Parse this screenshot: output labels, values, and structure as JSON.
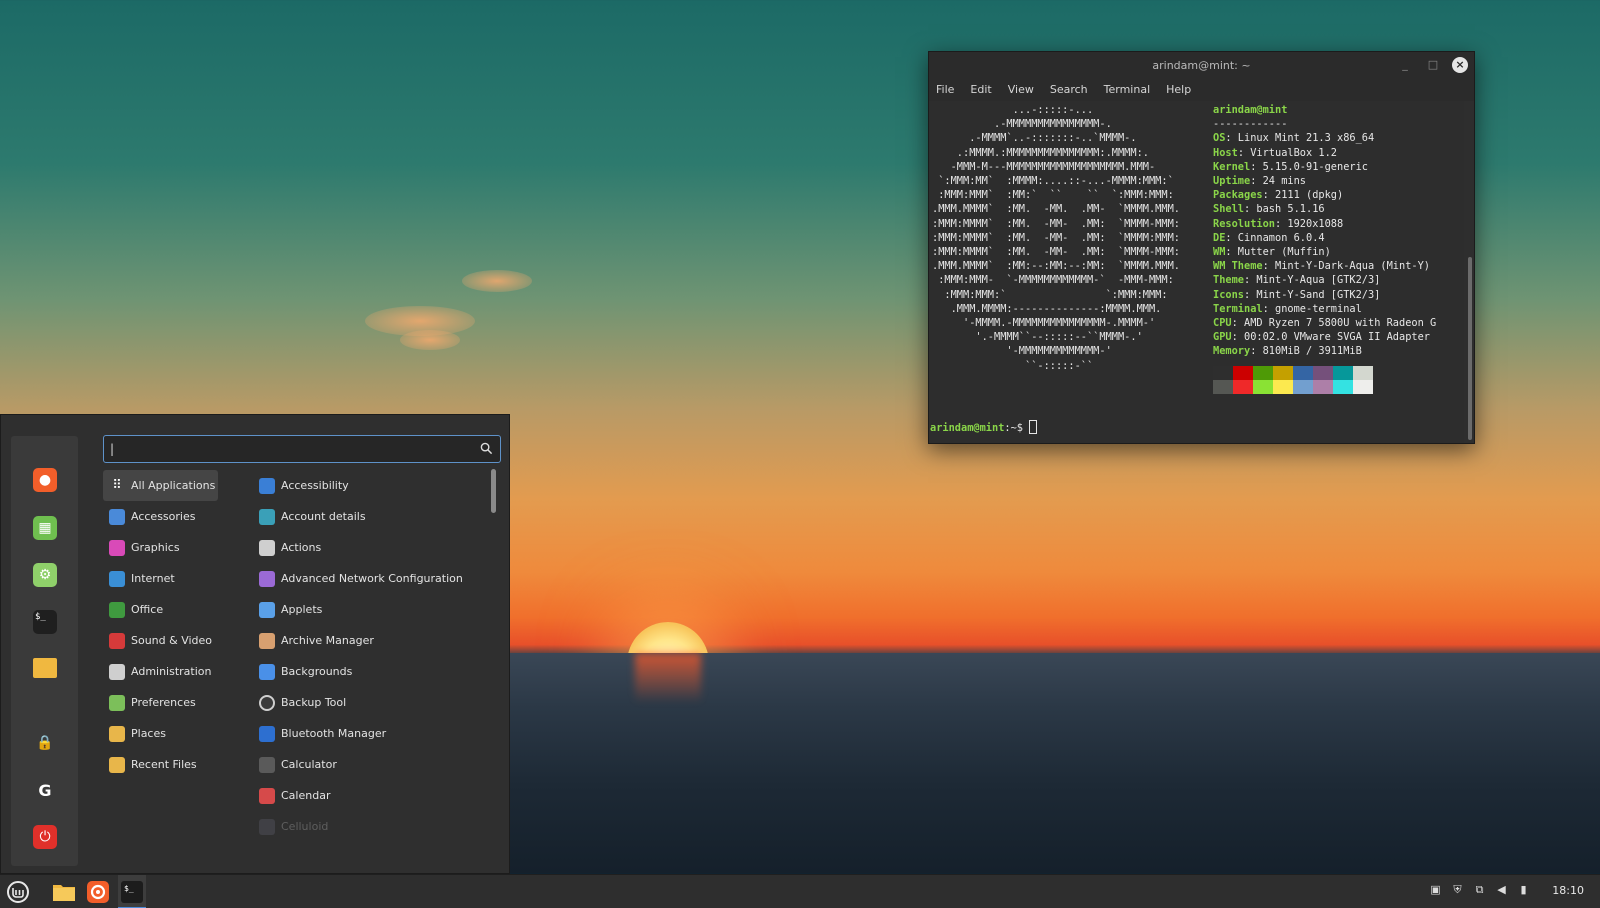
{
  "terminal": {
    "title": "arindam@mint: ~",
    "menu": [
      "File",
      "Edit",
      "View",
      "Search",
      "Terminal",
      "Help"
    ],
    "ascii_lines": [
      "             ...-:::::-...",
      "          .-MMMMMMMMMMMMMMM-.",
      "      .-MMMM`..-:::::::-..`MMMM-.",
      "    .:MMMM.:MMMMMMMMMMMMMMM:.MMMM:.",
      "   -MMM-M---MMMMMMMMMMMMMMMMMMM.MMM-",
      " `:MMM:MM`  :MMMM:....::-...-MMMM:MMM:`",
      " :MMM:MMM`  :MM:`  ``    ``  `:MMM:MMM:",
      ".MMM.MMMM`  :MM.  -MM.  .MM-  `MMMM.MMM.",
      ":MMM:MMMM`  :MM.  -MM-  .MM:  `MMMM-MMM:",
      ":MMM:MMMM`  :MM.  -MM-  .MM:  `MMMM:MMM:",
      ":MMM:MMMM`  :MM.  -MM-  .MM:  `MMMM-MMM:",
      ".MMM.MMMM`  :MM:--:MM:--:MM:  `MMMM.MMM.",
      " :MMM:MMM-  `-MMMMMMMMMMMM-`  -MMM-MMM:",
      "  :MMM:MMM:`                `:MMM:MMM:",
      "   .MMM.MMMM:--------------:MMMM.MMM.",
      "     '-MMMM.-MMMMMMMMMMMMMMM-.MMMM-'",
      "       '.-MMMM``--:::::--``MMMM-.'",
      "            '-MMMMMMMMMMMMM-'",
      "               ``-:::::-``"
    ],
    "user_host": "arindam@mint",
    "separator": "------------",
    "info": [
      {
        "key": "OS",
        "value": "Linux Mint 21.3 x86_64"
      },
      {
        "key": "Host",
        "value": "VirtualBox 1.2"
      },
      {
        "key": "Kernel",
        "value": "5.15.0-91-generic"
      },
      {
        "key": "Uptime",
        "value": "24 mins"
      },
      {
        "key": "Packages",
        "value": "2111 (dpkg)"
      },
      {
        "key": "Shell",
        "value": "bash 5.1.16"
      },
      {
        "key": "Resolution",
        "value": "1920x1088"
      },
      {
        "key": "DE",
        "value": "Cinnamon 6.0.4"
      },
      {
        "key": "WM",
        "value": "Mutter (Muffin)"
      },
      {
        "key": "WM Theme",
        "value": "Mint-Y-Dark-Aqua (Mint-Y)"
      },
      {
        "key": "Theme",
        "value": "Mint-Y-Aqua [GTK2/3]"
      },
      {
        "key": "Icons",
        "value": "Mint-Y-Sand [GTK2/3]"
      },
      {
        "key": "Terminal",
        "value": "gnome-terminal"
      },
      {
        "key": "CPU",
        "value": "AMD Ryzen 7 5800U with Radeon G"
      },
      {
        "key": "GPU",
        "value": "00:02.0 VMware SVGA II Adapter"
      },
      {
        "key": "Memory",
        "value": "810MiB / 3911MiB"
      }
    ],
    "palette_top": [
      "#2e2e2e",
      "#cc0000",
      "#4e9a06",
      "#c4a000",
      "#3465a4",
      "#75507b",
      "#06989a",
      "#d3d7cf"
    ],
    "palette_bottom": [
      "#555753",
      "#ef2929",
      "#8ae234",
      "#fce94f",
      "#729fcf",
      "#ad7fa8",
      "#34e2e2",
      "#eeeeec"
    ],
    "prompt_user": "arindam@mint",
    "prompt_rest": ":~$ "
  },
  "menu": {
    "search_value": "|",
    "categories": [
      {
        "label": "All Applications",
        "icon": "grid-icon",
        "color": "#444444"
      },
      {
        "label": "Accessories",
        "icon": "scissors-icon",
        "color": "#4a8ad9"
      },
      {
        "label": "Graphics",
        "icon": "palette-icon",
        "color": "#d94ab8"
      },
      {
        "label": "Internet",
        "icon": "cloud-icon",
        "color": "#3a8fd6"
      },
      {
        "label": "Office",
        "icon": "document-icon",
        "color": "#3f9a3f"
      },
      {
        "label": "Sound & Video",
        "icon": "play-icon",
        "color": "#d63a3a"
      },
      {
        "label": "Administration",
        "icon": "toggle-icon",
        "color": "#cfcfcf"
      },
      {
        "label": "Preferences",
        "icon": "preferences-icon",
        "color": "#7cbf5a"
      },
      {
        "label": "Places",
        "icon": "folder-icon",
        "color": "#e8b64a"
      },
      {
        "label": "Recent Files",
        "icon": "recent-folder-icon",
        "color": "#e8b64a"
      }
    ],
    "apps": [
      {
        "label": "Accessibility",
        "icon": "accessibility-icon",
        "color": "#3a7fd6"
      },
      {
        "label": "Account details",
        "icon": "account-icon",
        "color": "#3aa0b8"
      },
      {
        "label": "Actions",
        "icon": "list-icon",
        "color": "#cfcfcf"
      },
      {
        "label": "Advanced Network Configuration",
        "icon": "network-icon",
        "color": "#9b6ad6"
      },
      {
        "label": "Applets",
        "icon": "applets-icon",
        "color": "#5aa0e8"
      },
      {
        "label": "Archive Manager",
        "icon": "archive-icon",
        "color": "#d8a070"
      },
      {
        "label": "Backgrounds",
        "icon": "backgrounds-icon",
        "color": "#4a90e8"
      },
      {
        "label": "Backup Tool",
        "icon": "backup-icon",
        "color": "#3a3a3a"
      },
      {
        "label": "Bluetooth Manager",
        "icon": "bluetooth-icon",
        "color": "#2d6fd0"
      },
      {
        "label": "Calculator",
        "icon": "calculator-icon",
        "color": "#5a5a5a"
      },
      {
        "label": "Calendar",
        "icon": "calendar-icon",
        "color": "#d64a4a"
      },
      {
        "label": "Celluloid",
        "icon": "celluloid-icon",
        "color": "#5a5a66"
      }
    ],
    "favorites": [
      {
        "name": "firefox-icon",
        "color": "#f25e2a",
        "glyph": "●"
      },
      {
        "name": "software-manager-icon",
        "color": "#6fbf4f",
        "glyph": "▦"
      },
      {
        "name": "settings-toggle-icon",
        "color": "#8fd06a",
        "glyph": "⚙"
      },
      {
        "name": "terminal-icon",
        "color": "#1f1f1f",
        "glyph": "$_"
      },
      {
        "name": "files-folder-icon",
        "color": "#f0b840",
        "glyph": ""
      },
      {
        "name": "lock-icon",
        "color": "transparent",
        "glyph": "🔒"
      },
      {
        "name": "logout-icon",
        "color": "transparent",
        "glyph": "G"
      },
      {
        "name": "power-icon",
        "color": "#e0302a",
        "glyph": "⏻"
      }
    ]
  },
  "taskbar": {
    "clock": "18:10"
  }
}
